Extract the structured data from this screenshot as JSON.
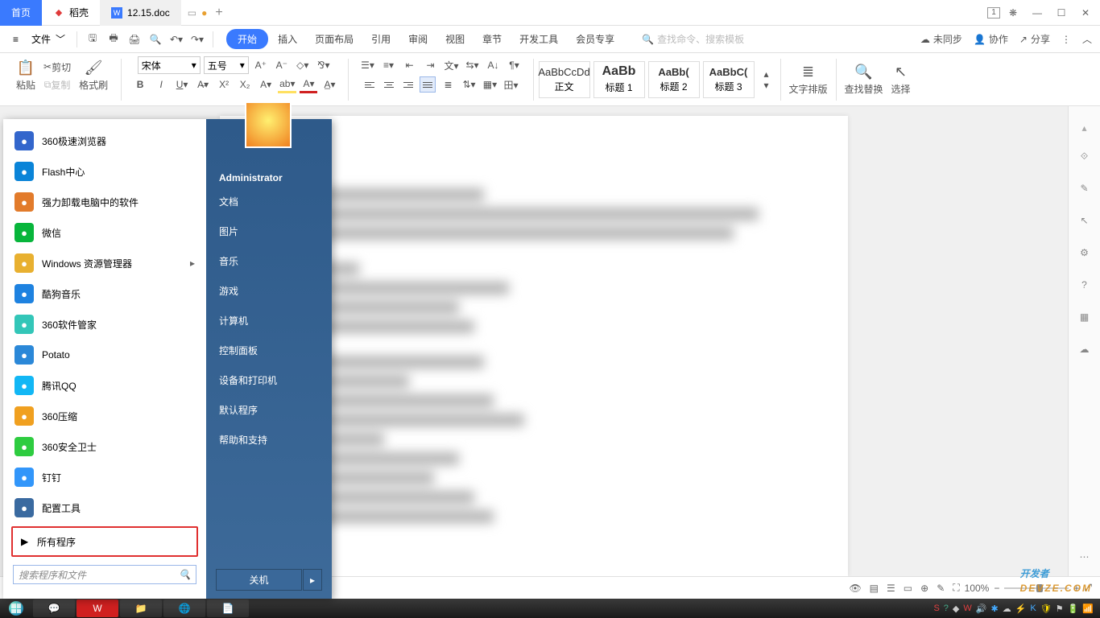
{
  "tabs": {
    "home": "首页",
    "docshell": "稻壳",
    "doc": "12.15.doc"
  },
  "menubar": {
    "file": "文件",
    "tabs": [
      "开始",
      "插入",
      "页面布局",
      "引用",
      "审阅",
      "视图",
      "章节",
      "开发工具",
      "会员专享"
    ],
    "search_ph": "查找命令、搜索模板",
    "unsync": "未同步",
    "collab": "协作",
    "share": "分享"
  },
  "ribbon": {
    "paste": "粘贴",
    "cut": "剪切",
    "copy": "复制",
    "brush": "格式刷",
    "font_name": "宋体",
    "font_size": "五号",
    "styles": [
      {
        "p": "AaBbCcDd",
        "n": "正文"
      },
      {
        "p": "AaBb",
        "n": "标题 1"
      },
      {
        "p": "AaBb(",
        "n": "标题 2"
      },
      {
        "p": "AaBbC(",
        "n": "标题 3"
      }
    ],
    "text_layout": "文字排版",
    "find_replace": "查找替换",
    "select": "选择"
  },
  "start_menu": {
    "left": [
      {
        "n": "360极速浏览器",
        "c": "#36c"
      },
      {
        "n": "Flash中心",
        "c": "#0a84d8"
      },
      {
        "n": "强力卸载电脑中的软件",
        "c": "#e27b2b"
      },
      {
        "n": "微信",
        "c": "#07b53b"
      },
      {
        "n": "Windows 资源管理器",
        "c": "#e8b030",
        "sub": true
      },
      {
        "n": "酷狗音乐",
        "c": "#1e82e0"
      },
      {
        "n": "360软件管家",
        "c": "#33c6b8"
      },
      {
        "n": "Potato",
        "c": "#2b88d8"
      },
      {
        "n": "腾讯QQ",
        "c": "#12b7f5"
      },
      {
        "n": "360压缩",
        "c": "#f0a020"
      },
      {
        "n": "360安全卫士",
        "c": "#2ecc40"
      },
      {
        "n": "钉钉",
        "c": "#3296fa"
      },
      {
        "n": "配置工具",
        "c": "#3a6aa0"
      }
    ],
    "all_programs": "所有程序",
    "search_ph": "搜索程序和文件",
    "user": "Administrator",
    "right": [
      "文档",
      "图片",
      "音乐",
      "游戏",
      "计算机",
      "控制面板",
      "设备和打印机",
      "默认程序",
      "帮助和支持"
    ],
    "shutdown": "关机"
  },
  "status": {
    "zoom": "100%"
  },
  "watermark": "开发者",
  "watermark_sub": "DEVZE.COM"
}
